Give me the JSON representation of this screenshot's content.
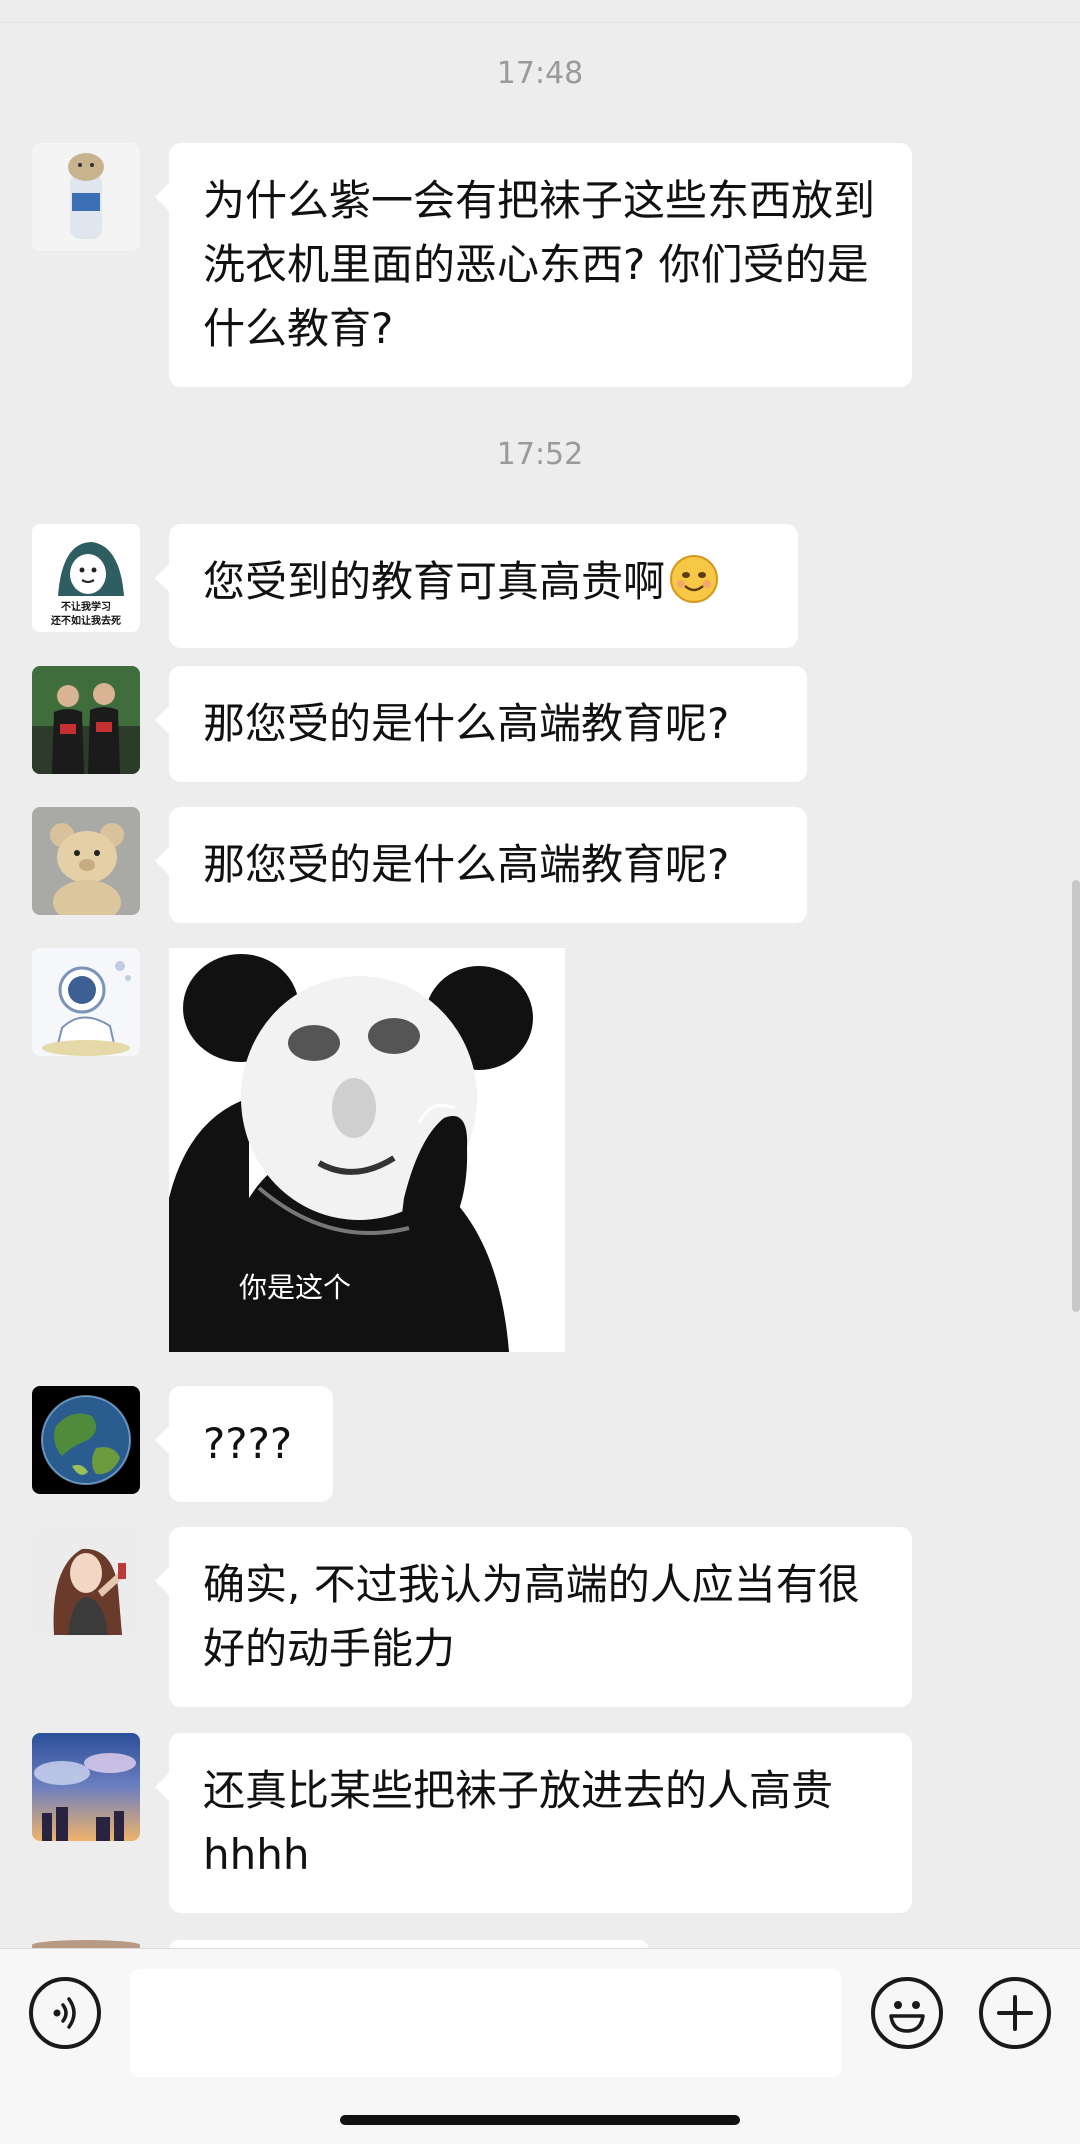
{
  "timestamps": [
    "17:48",
    "17:52"
  ],
  "messages": [
    {
      "avatar": "water-bottle-cat-avatar",
      "text": "为什么紫一会有把袜子这些东西放到洗衣机里面的恶心东西? 你们受的是什么教育?"
    },
    {
      "avatar": "hooded-cartoon-avatar",
      "text": "您受到的教育可真高贵啊",
      "emoji": "smiling-emoji",
      "avatar_caption_line1": "不让我学习",
      "avatar_caption_line2": "还不如让我去死"
    },
    {
      "avatar": "two-players-avatar",
      "text": "那您受的是什么高端教育呢?"
    },
    {
      "avatar": "teddy-bear-avatar",
      "text": "那您受的是什么高端教育呢?"
    },
    {
      "avatar": "astronaut-avatar",
      "sticker": "panda-meme-sticker",
      "sticker_caption": "你是这个"
    },
    {
      "avatar": "earth-avatar",
      "text": "????"
    },
    {
      "avatar": "anime-girl-avatar",
      "text": "确实, 不过我认为高端的人应当有很好的动手能力"
    },
    {
      "avatar": "sunset-clouds-avatar",
      "text": "还真比某些把袜子放进去的人高贵hhhh"
    }
  ],
  "input_bar": {
    "voice_icon": "voice-icon",
    "emoji_icon": "emoji-icon",
    "plus_icon": "plus-icon",
    "text_value": ""
  }
}
